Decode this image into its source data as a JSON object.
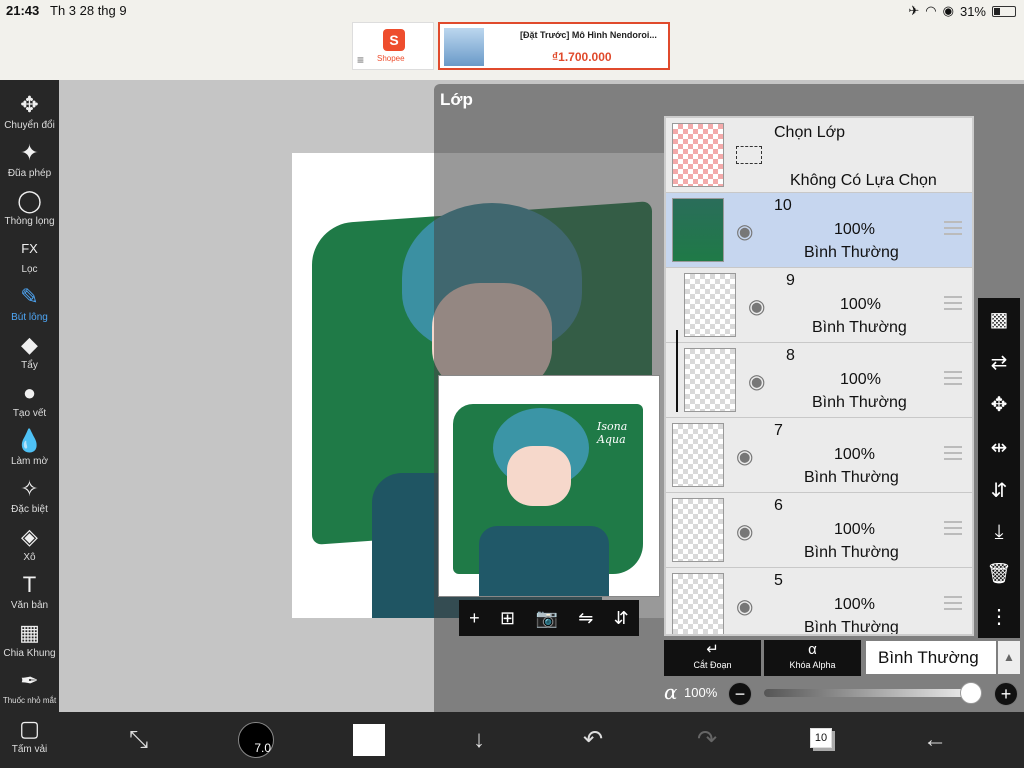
{
  "status_bar": {
    "time": "21:43",
    "date": "Th 3 28 thg 9",
    "battery": "31%",
    "battery_level": 0.31
  },
  "ad": {
    "shopee_label": "Shopee",
    "shopee_glyph": "S",
    "title": "[Đặt Trước] Mô Hình Nendoroi...",
    "price": "₫1.700.000"
  },
  "toolbar": {
    "items": [
      {
        "label": "Chuyển đổi",
        "icon": "move-icon",
        "glyph": "✥"
      },
      {
        "label": "Đũa phép",
        "icon": "magic-wand-icon",
        "glyph": "✦"
      },
      {
        "label": "Thòng lọng",
        "icon": "lasso-icon",
        "glyph": "◯"
      },
      {
        "label": "Lọc",
        "icon": "fx-icon",
        "glyph": "FX"
      },
      {
        "label": "Bút lông",
        "icon": "brush-icon",
        "glyph": "✎",
        "active": true
      },
      {
        "label": "Tẩy",
        "icon": "eraser-icon",
        "glyph": "◆"
      },
      {
        "label": "Tạo vết",
        "icon": "smudge-icon",
        "glyph": "●"
      },
      {
        "label": "Làm mờ",
        "icon": "blur-drop-icon",
        "glyph": "💧"
      },
      {
        "label": "Đặc biệt",
        "icon": "sparkle-icon",
        "glyph": "✧"
      },
      {
        "label": "Xô",
        "icon": "bucket-icon",
        "glyph": "◈"
      },
      {
        "label": "Văn bản",
        "icon": "text-icon",
        "glyph": "T"
      },
      {
        "label": "Chia Khung",
        "icon": "frame-divider-icon",
        "glyph": "▦"
      },
      {
        "label": "Thuốc nhỏ mắt",
        "icon": "eyedropper-icon",
        "glyph": "✒"
      },
      {
        "label": "Tấm vải",
        "icon": "canvas-icon",
        "glyph": "▢"
      }
    ]
  },
  "layer_panel": {
    "title": "Lớp",
    "selection_row": {
      "title": "Chọn Lớp",
      "status": "Không Có Lựa Chọn"
    },
    "layers": [
      {
        "number": "10",
        "opacity": "100%",
        "mode": "Bình Thường",
        "selected": true
      },
      {
        "number": "9",
        "opacity": "100%",
        "mode": "Bình Thường",
        "clipped": true
      },
      {
        "number": "8",
        "opacity": "100%",
        "mode": "Bình Thường",
        "clipped": true
      },
      {
        "number": "7",
        "opacity": "100%",
        "mode": "Bình Thường"
      },
      {
        "number": "6",
        "opacity": "100%",
        "mode": "Bình Thường"
      },
      {
        "number": "5",
        "opacity": "100%",
        "mode": "Bình Thường"
      }
    ],
    "preview_text": "Isona\nAqua",
    "preview_tools": [
      "+",
      "⊞",
      "📷",
      "⇋",
      "⇵"
    ],
    "clip_button": {
      "label": "Cắt Đoạn",
      "glyph": "↵"
    },
    "alpha_lock_button": {
      "label": "Khóa Alpha",
      "glyph": "α"
    },
    "blend_mode": "Bình Thường",
    "blend_arrow": "▲",
    "alpha": {
      "symbol": "α",
      "value": "100%",
      "level": 1.0,
      "minus": "−",
      "plus": "+"
    }
  },
  "right_tools": [
    {
      "icon": "transparency-icon",
      "glyph": "▩"
    },
    {
      "icon": "transform-layer-icon",
      "glyph": "⇄"
    },
    {
      "icon": "move-layer-icon",
      "glyph": "✥"
    },
    {
      "icon": "flip-horizontal-icon",
      "glyph": "⇹"
    },
    {
      "icon": "flip-vertical-icon",
      "glyph": "⇵"
    },
    {
      "icon": "merge-down-icon",
      "glyph": "⤓"
    },
    {
      "icon": "trash-icon",
      "glyph": "🗑"
    },
    {
      "icon": "more-icon",
      "glyph": "⋮"
    }
  ],
  "bottom_bar": {
    "brush_size": "7.0",
    "layer_count": "10",
    "icons": {
      "adjust": "⤡",
      "down": "↓",
      "undo": "↶",
      "redo": "↷",
      "back": "←"
    }
  }
}
